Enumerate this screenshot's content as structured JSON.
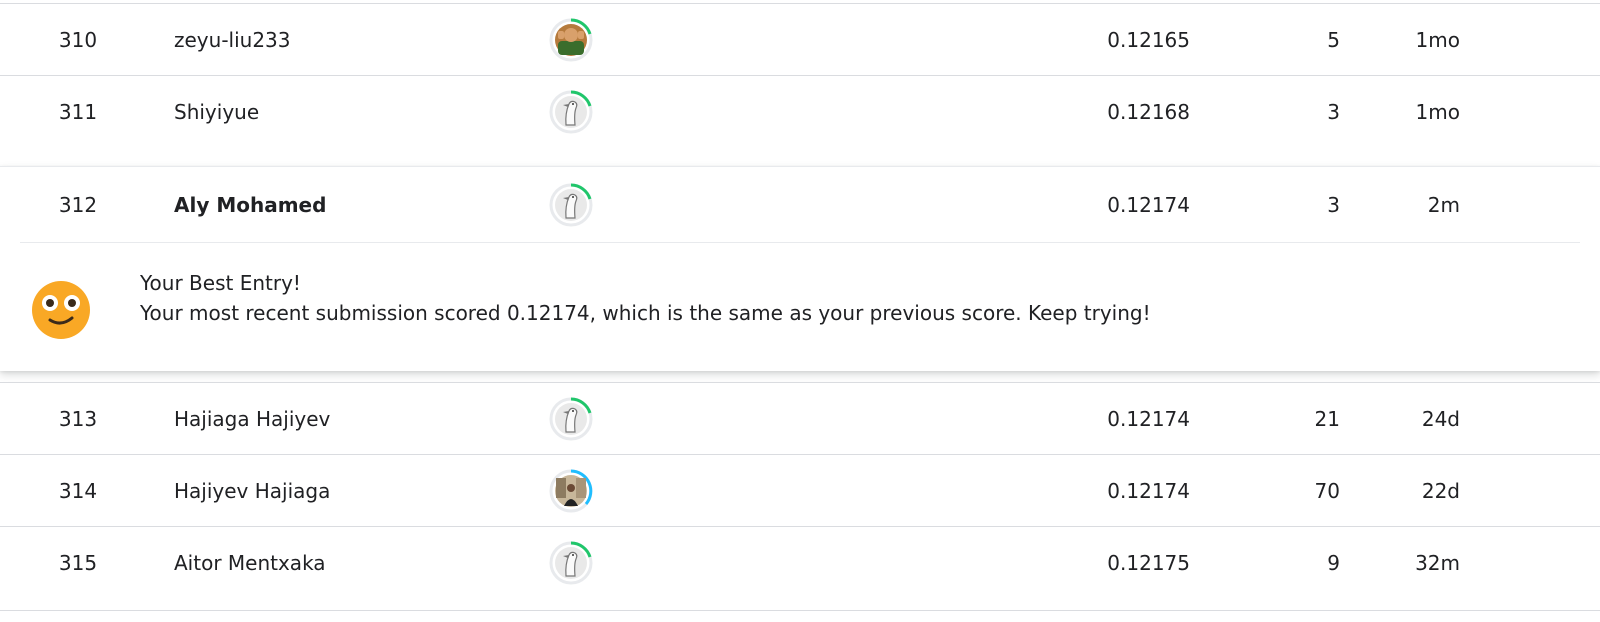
{
  "rows_above": [
    {
      "rank": "310",
      "team": "zeyu-liu233",
      "score": "0.12165",
      "entries": "5",
      "last": "1mo",
      "avatar": "photo-avatar-icon",
      "ring": "#20c66b"
    },
    {
      "rank": "311",
      "team": "Shiyiyue",
      "score": "0.12168",
      "entries": "3",
      "last": "1mo",
      "avatar": "goose-avatar-icon",
      "ring": "#20c66b"
    }
  ],
  "current": {
    "rank": "312",
    "team": "Aly Mohamed",
    "score": "0.12174",
    "entries": "3",
    "last": "2m",
    "avatar": "goose-avatar-icon",
    "ring": "#20c66b"
  },
  "message": {
    "title": "Your Best Entry!",
    "body": "Your most recent submission scored 0.12174, which is the same as your previous score. Keep trying!",
    "icon": "smiley-face-icon",
    "icon_color": "#f9a825"
  },
  "rows_below": [
    {
      "rank": "313",
      "team": "Hajiaga Hajiyev",
      "score": "0.12174",
      "entries": "21",
      "last": "24d",
      "avatar": "goose-avatar-icon",
      "ring": "#20c66b"
    },
    {
      "rank": "314",
      "team": "Hajiyev Hajiaga",
      "score": "0.12174",
      "entries": "70",
      "last": "22d",
      "avatar": "photo-avatar-icon",
      "ring": "#20beff"
    },
    {
      "rank": "315",
      "team": "Aitor Mentxaka",
      "score": "0.12175",
      "entries": "9",
      "last": "32m",
      "avatar": "goose-avatar-icon",
      "ring": "#20c66b"
    }
  ]
}
